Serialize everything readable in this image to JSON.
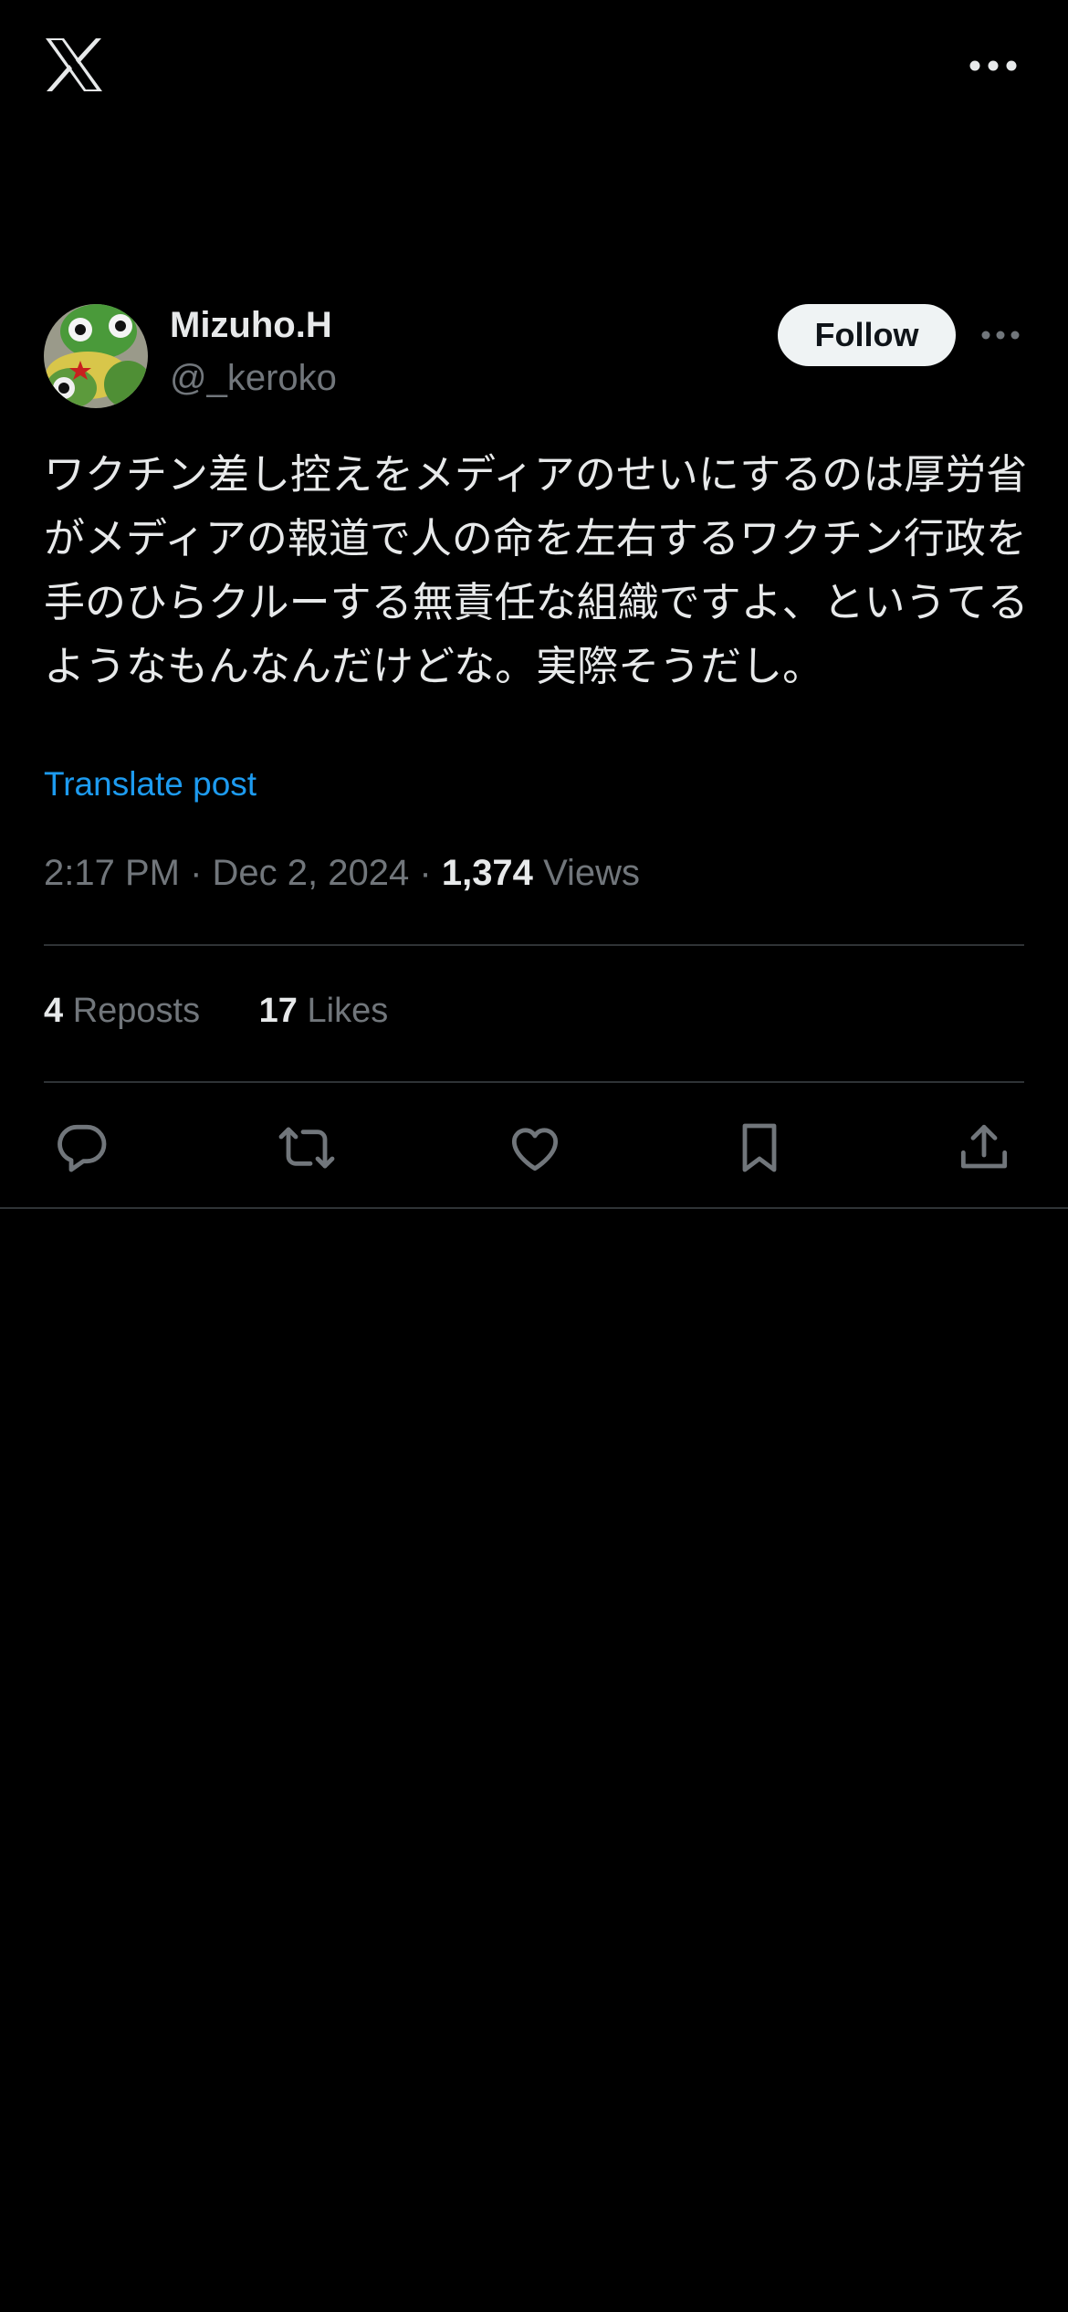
{
  "icons": {
    "logo": "x-logo-icon",
    "more": "more-horizontal-icon",
    "reply": "reply-icon",
    "repost": "repost-icon",
    "like": "heart-icon",
    "bookmark": "bookmark-icon",
    "share": "share-icon"
  },
  "colors": {
    "background": "#000000",
    "text": "#e7e9ea",
    "muted": "#71767b",
    "link": "#1d9bf0",
    "divider": "#2f3336",
    "follow_bg": "#eff3f4"
  },
  "author": {
    "name": "Mizuho.H",
    "handle": "@_keroko",
    "follow_label": "Follow"
  },
  "tweet": {
    "text": "ワクチン差し控えをメディアのせいにするのは厚労省がメディアの報道で人の命を左右するワクチン行政を手のひらクルーする無責任な組織ですよ、というてるようなもんなんだけどな。実際そうだし。",
    "translate_label": "Translate post",
    "time": "2:17 PM",
    "separator": "·",
    "date": "Dec 2, 2024",
    "views_count": "1,374",
    "views_label": "Views"
  },
  "stats": {
    "reposts_count": "4",
    "reposts_label": "Reposts",
    "likes_count": "17",
    "likes_label": "Likes"
  }
}
